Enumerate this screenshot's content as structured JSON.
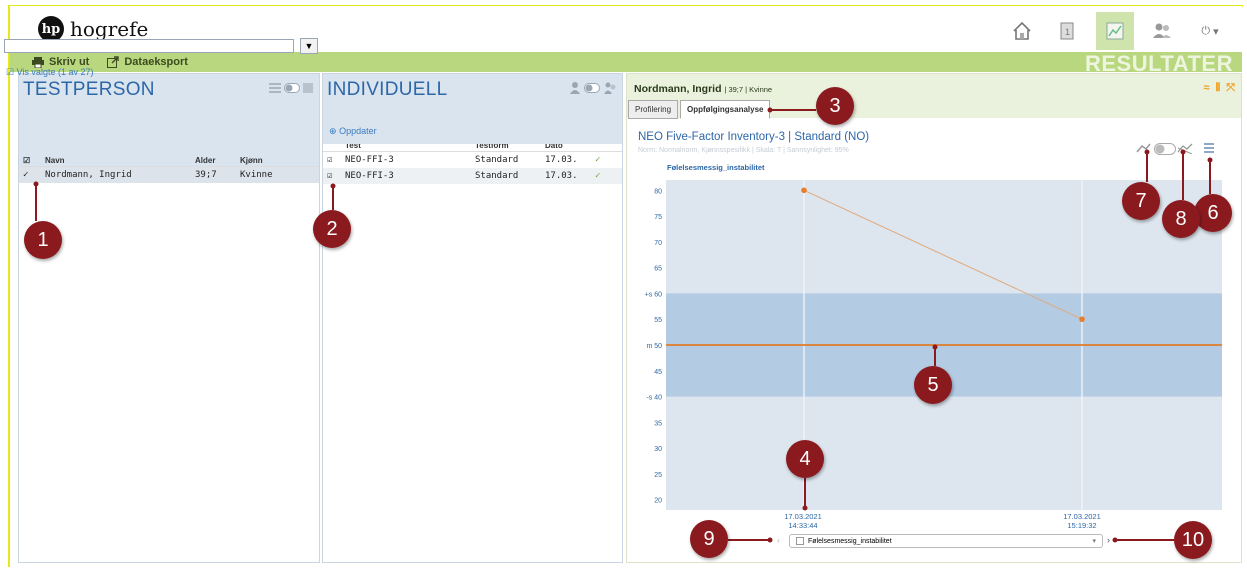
{
  "brand": {
    "name": "hogrefe",
    "mark": "hp"
  },
  "nav": {
    "icons": [
      "home-icon",
      "book-icon",
      "chart-icon",
      "users-icon",
      "power-icon"
    ],
    "power_caret": "▾"
  },
  "toolbar": {
    "print_label": "Skriv ut",
    "export_label": "Dataeksport",
    "section_title": "RESULTATER"
  },
  "testperson": {
    "title": "TESTPERSON",
    "show_selected": "Vis valgte (1 av 27)",
    "columns": [
      "Navn",
      "Alder",
      "Kjønn"
    ],
    "rows": [
      {
        "name": "Nordmann, Ingrid",
        "age": "39;7",
        "gender": "Kvinne"
      }
    ]
  },
  "individuell": {
    "title": "INDIVIDUELL",
    "refresh_label": "Oppdater",
    "columns": [
      "Test",
      "Testform",
      "Dato"
    ],
    "rows": [
      {
        "test": "NEO-FFI-3",
        "form": "Standard",
        "date": "17.03."
      },
      {
        "test": "NEO-FFI-3",
        "form": "Standard",
        "date": "17.03."
      }
    ]
  },
  "results": {
    "person_name": "Nordmann, Ingrid",
    "person_meta": "| 39;7 | Kvinne",
    "tabs": [
      "Profilering",
      "Oppfølgingsanalyse"
    ],
    "active_tab": 1,
    "chart_title": "NEO Five-Factor Inventory-3 | Standard (NO)",
    "chart_subtitle": "Norm: Normalnorm, Kjønnsspesifikk | Skala: T | Sannsynlighet: 95%",
    "series_label": "Følelsesmessig_instabilitet",
    "select_value": "Følelsesmessig_instabilitet"
  },
  "chart_data": {
    "type": "line",
    "x": [
      "17.03.2021 14:33:44",
      "17.03.2021 15:19:32"
    ],
    "series": [
      {
        "name": "Følelsesmessig_instabilitet",
        "values": [
          80,
          55
        ]
      }
    ],
    "ylim": [
      18,
      82
    ],
    "yticks": [
      "20",
      "25",
      "30",
      "35",
      "-s 40",
      "45",
      "m 50",
      "55",
      "+s 60",
      "65",
      "70",
      "75",
      "80"
    ],
    "ytick_values": [
      20,
      25,
      30,
      35,
      40,
      45,
      50,
      55,
      60,
      65,
      70,
      75,
      80
    ],
    "band": [
      40,
      60
    ],
    "mean_line": 50,
    "colors": {
      "band": "#b3cbe3",
      "plot_bg": "#dde5ee",
      "line": "#e2a97a",
      "point": "#e87d2b",
      "mean": "#e07b29"
    }
  },
  "callouts": [
    "1",
    "2",
    "3",
    "4",
    "5",
    "6",
    "7",
    "8",
    "9",
    "10"
  ]
}
